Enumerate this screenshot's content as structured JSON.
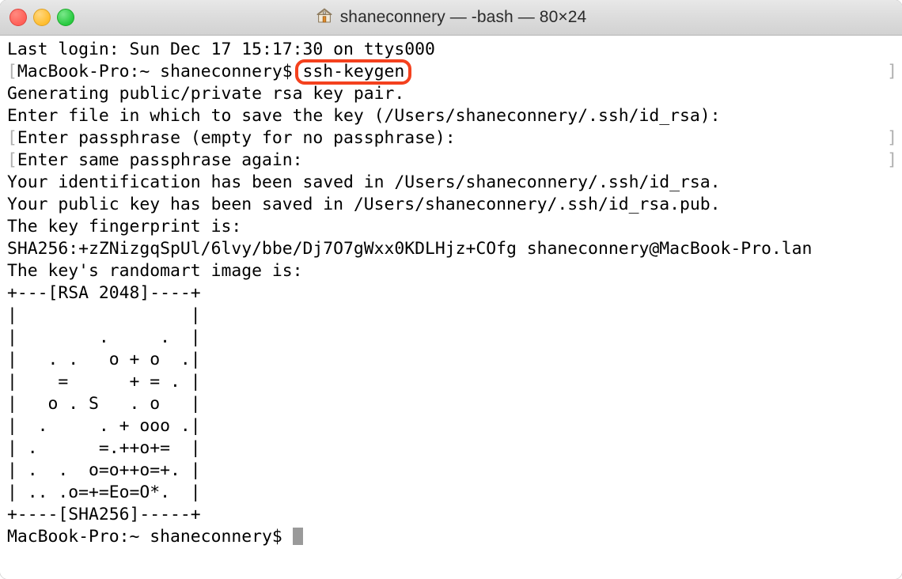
{
  "window": {
    "title": "shaneconnery — -bash — 80×24",
    "icon": "home-icon",
    "traffic_lights": {
      "close_color": "#ff5f57",
      "minimize_color": "#ffbd2e",
      "maximize_color": "#28c940"
    }
  },
  "terminal": {
    "background": "#ffffff",
    "foreground": "#000000",
    "bracket_color": "#b0b0b0",
    "cursor_color": "#9a9a9a",
    "lines": [
      {
        "text": "Last login: Sun Dec 17 15:17:30 on ttys000",
        "lead": "",
        "trail": ""
      },
      {
        "text": "MacBook-Pro:~ shaneconnery$ ssh-keygen",
        "lead": "[",
        "trail": "]"
      },
      {
        "text": "Generating public/private rsa key pair.",
        "lead": "",
        "trail": ""
      },
      {
        "text": "Enter file in which to save the key (/Users/shaneconnery/.ssh/id_rsa):",
        "lead": "",
        "trail": ""
      },
      {
        "text": "Enter passphrase (empty for no passphrase):",
        "lead": "[",
        "trail": "]"
      },
      {
        "text": "Enter same passphrase again:",
        "lead": "[",
        "trail": "]"
      },
      {
        "text": "Your identification has been saved in /Users/shaneconnery/.ssh/id_rsa.",
        "lead": "",
        "trail": ""
      },
      {
        "text": "Your public key has been saved in /Users/shaneconnery/.ssh/id_rsa.pub.",
        "lead": "",
        "trail": ""
      },
      {
        "text": "The key fingerprint is:",
        "lead": "",
        "trail": ""
      },
      {
        "text": "SHA256:+zZNizgqSpUl/6lvy/bbe/Dj7O7gWxx0KDLHjz+COfg shaneconnery@MacBook-Pro.lan",
        "lead": "",
        "trail": ""
      },
      {
        "text": "The key's randomart image is:",
        "lead": "",
        "trail": ""
      },
      {
        "text": "+---[RSA 2048]----+",
        "lead": "",
        "trail": ""
      },
      {
        "text": "|                 |",
        "lead": "",
        "trail": ""
      },
      {
        "text": "|        .     .  |",
        "lead": "",
        "trail": ""
      },
      {
        "text": "|   . .   o + o  .|",
        "lead": "",
        "trail": ""
      },
      {
        "text": "|    =      + = . |",
        "lead": "",
        "trail": ""
      },
      {
        "text": "|   o . S   . o   |",
        "lead": "",
        "trail": ""
      },
      {
        "text": "|  .     . + ooo .|",
        "lead": "",
        "trail": ""
      },
      {
        "text": "| .      =.++o+=  |",
        "lead": "",
        "trail": ""
      },
      {
        "text": "| .  .  o=o++o=+. |",
        "lead": "",
        "trail": ""
      },
      {
        "text": "| .. .o=+=Eo=O*.  |",
        "lead": "",
        "trail": ""
      },
      {
        "text": "+----[SHA256]-----+",
        "lead": "",
        "trail": ""
      }
    ],
    "prompt": {
      "text": "MacBook-Pro:~ shaneconnery$ ",
      "cursor": "block-cursor"
    }
  },
  "annotation": {
    "label": "ssh-keygen",
    "color": "#f4411e",
    "shape": "rounded-rectangle"
  }
}
